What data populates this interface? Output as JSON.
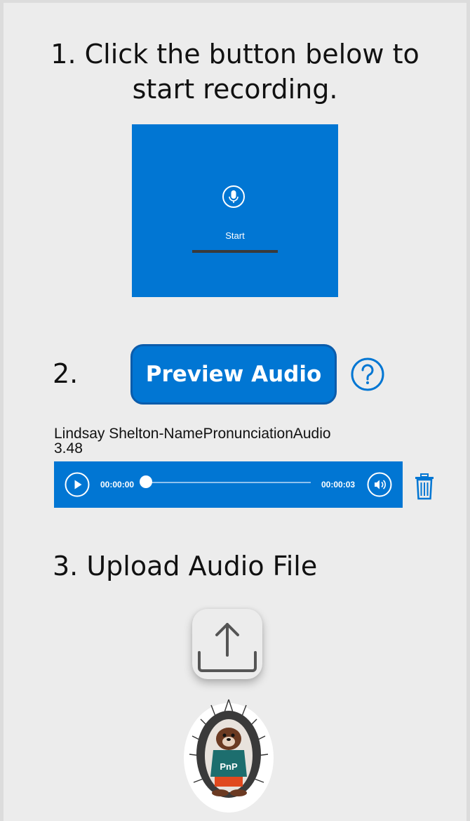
{
  "step1": {
    "title_line1": "1. Click the button below to",
    "title_line2": "start recording."
  },
  "recorder": {
    "icon": "microphone-icon",
    "start_label": "Start"
  },
  "step2": {
    "number": "2.",
    "preview_label": "Preview Audio",
    "help_icon": "question-icon"
  },
  "audio": {
    "file_name": "Lindsay Shelton-NamePronunciationAudio",
    "file_size": "3.48",
    "current_time": "00:00:00",
    "total_time": "00:00:03",
    "progress": 0
  },
  "step3": {
    "title": "3.  Upload Audio File",
    "upload_icon": "upload-icon"
  },
  "mascot": {
    "shirt_text": "PnP"
  },
  "colors": {
    "accent": "#0176d3",
    "accent_dark": "#0b5cab",
    "background": "#ececec"
  }
}
